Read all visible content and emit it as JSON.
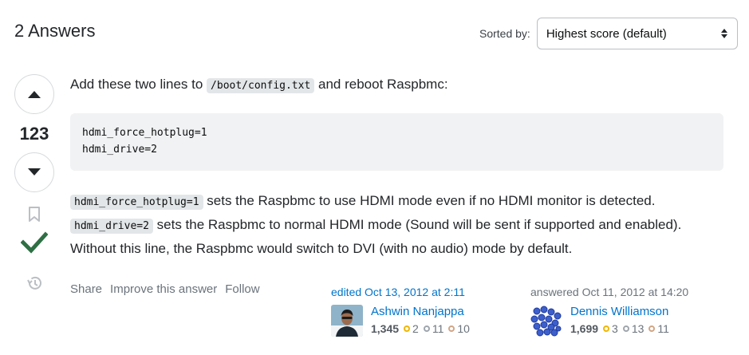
{
  "header": {
    "answers_count": "2 Answers",
    "sort_label": "Sorted by:",
    "sort_value": "Highest score (default)"
  },
  "vote": {
    "score": "123"
  },
  "answer": {
    "intro_before": "Add these two lines to ",
    "intro_code": "/boot/config.txt",
    "intro_after": " and reboot Raspbmc:",
    "code_lines": [
      "hdmi_force_hotplug=1",
      "hdmi_drive=2"
    ],
    "p2_code1": "hdmi_force_hotplug=1",
    "p2_text1": " sets the Raspbmc to use HDMI mode even if no HDMI monitor is detected.",
    "p2_code2": "hdmi_drive=2",
    "p2_text2": " sets the Raspbmc to normal HDMI mode (Sound will be sent if supported and enabled). Without this line, the Raspbmc would switch to DVI (with no audio) mode by default."
  },
  "menu": {
    "share": "Share",
    "improve": "Improve this answer",
    "follow": "Follow"
  },
  "editor": {
    "action": "edited Oct 13, 2012 at 2:11",
    "name": "Ashwin Nanjappa",
    "rep": "1,345",
    "gold": "2",
    "silver": "11",
    "bronze": "10"
  },
  "author": {
    "action": "answered Oct 11, 2012 at 14:20",
    "name": "Dennis Williamson",
    "rep": "1,699",
    "gold": "3",
    "silver": "13",
    "bronze": "11"
  },
  "colors": {
    "link": "#0074cc",
    "accepted": "#2f6f44",
    "gold": "#f1b600",
    "silver": "#9fa6ad",
    "bronze": "#d1a684"
  },
  "icons": [
    "upvote-arrow-icon",
    "downvote-arrow-icon",
    "bookmark-icon",
    "accepted-checkmark-icon",
    "history-icon",
    "select-arrows-icon"
  ]
}
